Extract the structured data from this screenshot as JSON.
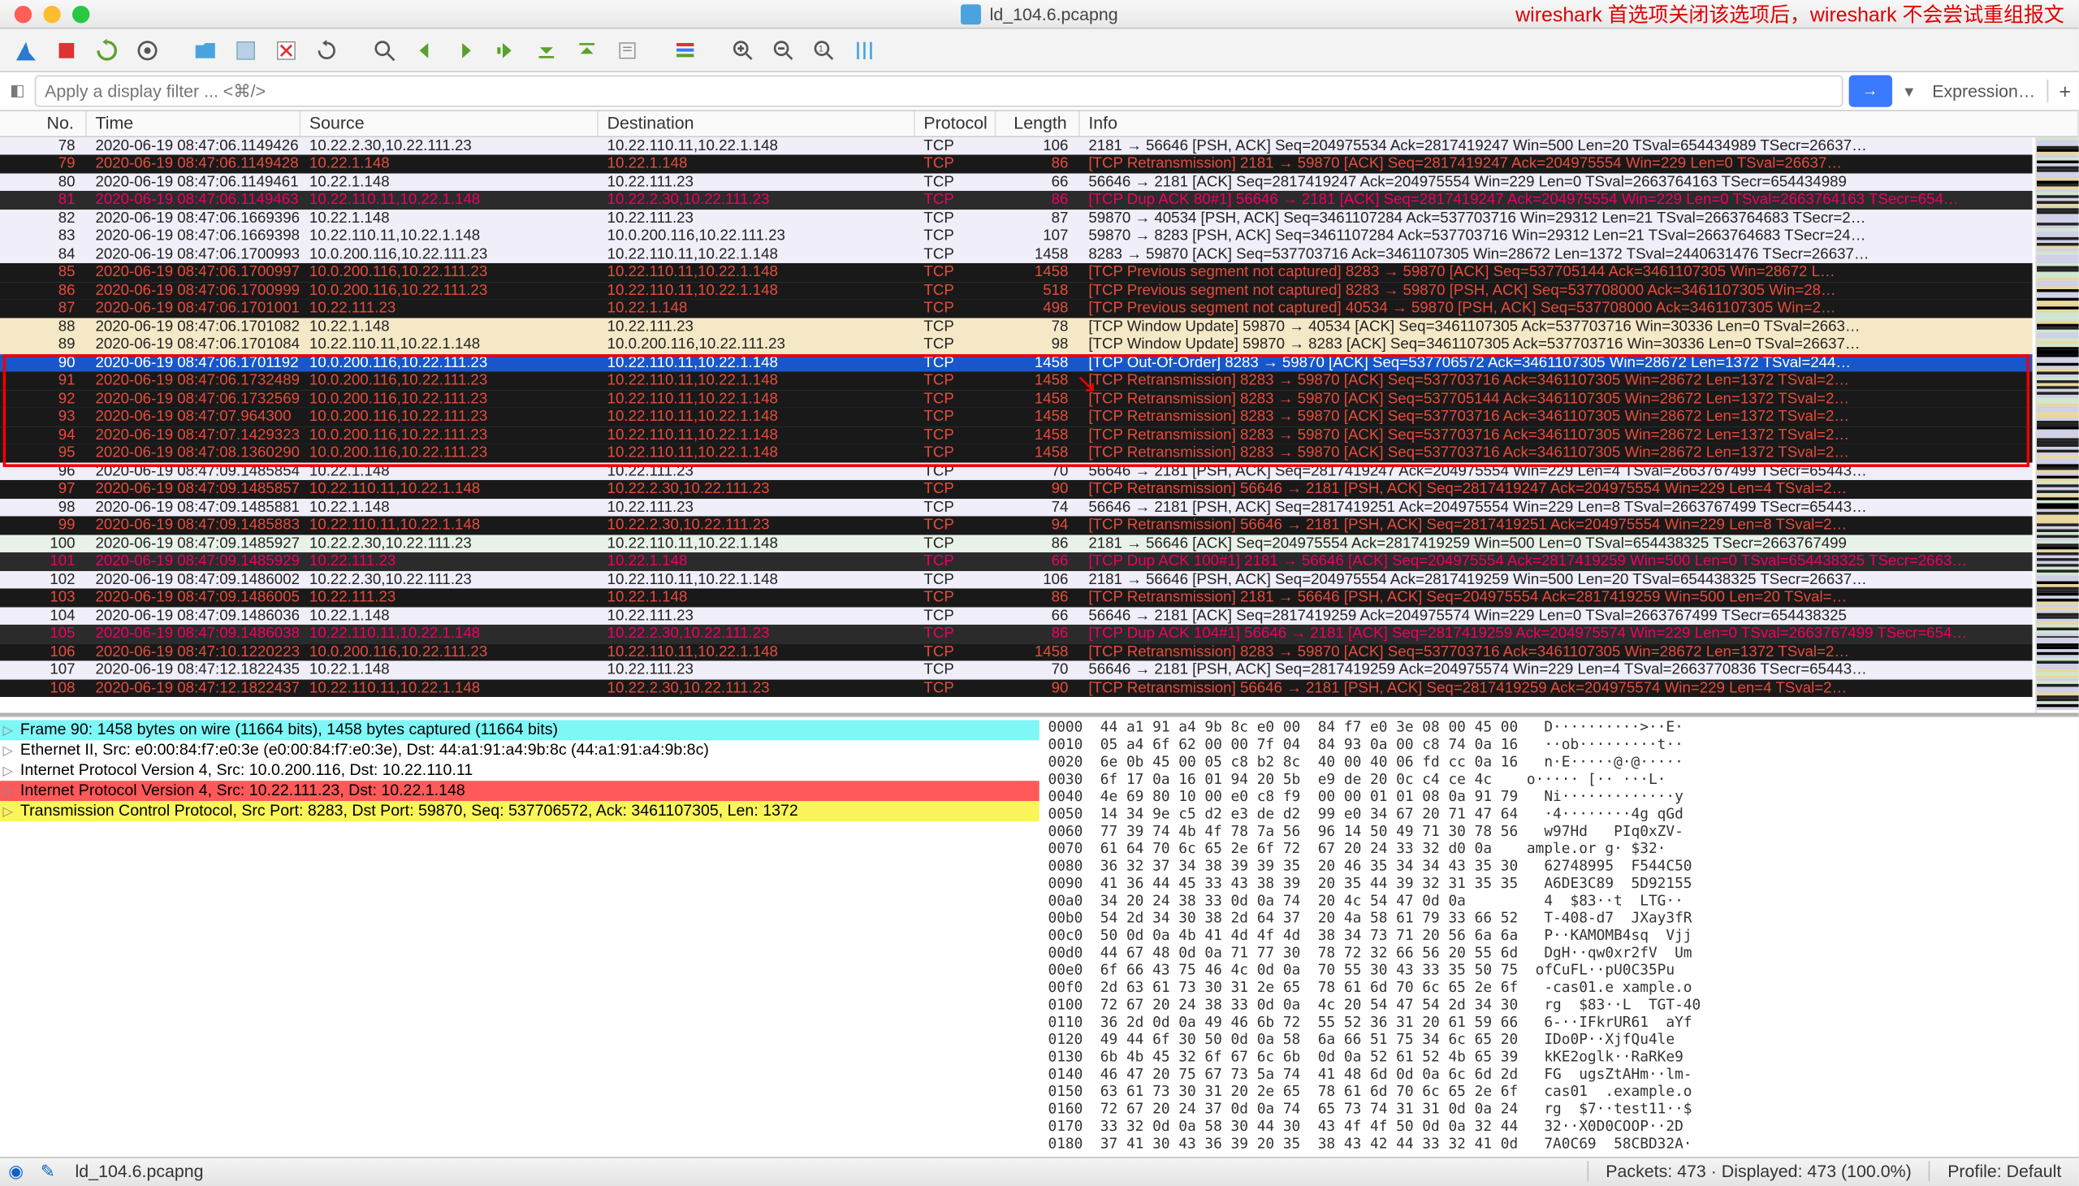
{
  "title": "ld_104.6.pcapng",
  "annotation": "wireshark 首选项关闭该选项后，wireshark 不会尝试重组报文",
  "filter_placeholder": "Apply a display filter ... <⌘/>",
  "expression_label": "Expression…",
  "columns": {
    "no": "No.",
    "time": "Time",
    "src": "Source",
    "dst": "Destination",
    "proto": "Protocol",
    "len": "Length",
    "info": "Info"
  },
  "rows": [
    {
      "n": 78,
      "t": "2020-06-19 08:47:06.1149426",
      "s": "10.22.2.30,10.22.111.23",
      "d": "10.22.110.11,10.22.1.148",
      "p": "TCP",
      "l": 106,
      "i": "2181 → 56646 [PSH, ACK] Seq=204975534 Ack=2817419247 Win=500 Len=20 TSval=654434989 TSecr=26637…",
      "cls": "c-light"
    },
    {
      "n": 79,
      "t": "2020-06-19 08:47:06.1149428",
      "s": "10.22.1.148",
      "d": "10.22.1.148",
      "p": "TCP",
      "l": 86,
      "i": "[TCP Retransmission] 2181 → 59870 [ACK] Seq=2817419247 Ack=204975554 Win=229 Len=0 TSval=26637…",
      "cls": "c-black"
    },
    {
      "n": 80,
      "t": "2020-06-19 08:47:06.1149461",
      "s": "10.22.1.148",
      "d": "10.22.111.23",
      "p": "TCP",
      "l": 66,
      "i": "56646 → 2181 [ACK] Seq=2817419247 Ack=204975554 Win=229 Len=0 TSval=2663764163 TSecr=654434989",
      "cls": "c-light"
    },
    {
      "n": 81,
      "t": "2020-06-19 08:47:06.1149463",
      "s": "10.22.110.11,10.22.1.148",
      "d": "10.22.2.30,10.22.111.23",
      "p": "TCP",
      "l": 86,
      "i": "[TCP Dup ACK 80#1] 56646 → 2181 [ACK] Seq=2817419247 Ack=204975554 Win=229 Len=0 TSval=2663764163 TSecr=654…",
      "cls": "c-dark"
    },
    {
      "n": 82,
      "t": "2020-06-19 08:47:06.1669396",
      "s": "10.22.1.148",
      "d": "10.22.111.23",
      "p": "TCP",
      "l": 87,
      "i": "59870 → 40534 [PSH, ACK] Seq=3461107284 Ack=537703716 Win=29312 Len=21 TSval=2663764683 TSecr=2…",
      "cls": "c-light"
    },
    {
      "n": 83,
      "t": "2020-06-19 08:47:06.1669398",
      "s": "10.22.110.11,10.22.1.148",
      "d": "10.0.200.116,10.22.111.23",
      "p": "TCP",
      "l": 107,
      "i": "59870 → 8283 [PSH, ACK] Seq=3461107284 Ack=537703716 Win=29312 Len=21 TSval=2663764683 TSecr=24…",
      "cls": "c-light"
    },
    {
      "n": 84,
      "t": "2020-06-19 08:47:06.1700993",
      "s": "10.0.200.116,10.22.111.23",
      "d": "10.22.110.11,10.22.1.148",
      "p": "TCP",
      "l": 1458,
      "i": "8283 → 59870 [ACK] Seq=537703716 Ack=3461107305 Win=28672 Len=1372 TSval=2440631476 TSecr=26637…",
      "cls": "c-light"
    },
    {
      "n": 85,
      "t": "2020-06-19 08:47:06.1700997",
      "s": "10.0.200.116,10.22.111.23",
      "d": "10.22.110.11,10.22.1.148",
      "p": "TCP",
      "l": 1458,
      "i": "[TCP Previous segment not captured] 8283 → 59870 [ACK] Seq=537705144 Ack=3461107305 Win=28672 L…",
      "cls": "c-black"
    },
    {
      "n": 86,
      "t": "2020-06-19 08:47:06.1700999",
      "s": "10.0.200.116,10.22.111.23",
      "d": "10.22.110.11,10.22.1.148",
      "p": "TCP",
      "l": 518,
      "i": "[TCP Previous segment not captured] 8283 → 59870 [PSH, ACK] Seq=537708000 Ack=3461107305 Win=28…",
      "cls": "c-black"
    },
    {
      "n": 87,
      "t": "2020-06-19 08:47:06.1701001",
      "s": "10.22.111.23",
      "d": "10.22.1.148",
      "p": "TCP",
      "l": 498,
      "i": "[TCP Previous segment not captured] 40534 → 59870 [PSH, ACK] Seq=537708000 Ack=3461107305 Win=2…",
      "cls": "c-black"
    },
    {
      "n": 88,
      "t": "2020-06-19 08:47:06.1701082",
      "s": "10.22.1.148",
      "d": "10.22.111.23",
      "p": "TCP",
      "l": 78,
      "i": "[TCP Window Update] 59870 → 40534 [ACK] Seq=3461107305 Ack=537703716 Win=30336 Len=0 TSval=2663…",
      "cls": "c-tan"
    },
    {
      "n": 89,
      "t": "2020-06-19 08:47:06.1701084",
      "s": "10.22.110.11,10.22.1.148",
      "d": "10.0.200.116,10.22.111.23",
      "p": "TCP",
      "l": 98,
      "i": "[TCP Window Update] 59870 → 8283 [ACK] Seq=3461107305 Ack=537703716 Win=30336 Len=0 TSval=26637…",
      "cls": "c-tan"
    },
    {
      "n": 90,
      "t": "2020-06-19 08:47:06.1701192",
      "s": "10.0.200.116,10.22.111.23",
      "d": "10.22.110.11,10.22.1.148",
      "p": "TCP",
      "l": 1458,
      "i": "[TCP Out-Of-Order] 8283 → 59870 [ACK] Seq=537706572 Ack=3461107305 Win=28672 Len=1372 TSval=244…",
      "cls": "c-sel"
    },
    {
      "n": 91,
      "t": "2020-06-19 08:47:06.1732489",
      "s": "10.0.200.116,10.22.111.23",
      "d": "10.22.110.11,10.22.1.148",
      "p": "TCP",
      "l": 1458,
      "i": "[TCP Retransmission] 8283 → 59870 [ACK] Seq=537703716 Ack=3461107305 Win=28672 Len=1372 TSval=2…",
      "cls": "c-red-on-black"
    },
    {
      "n": 92,
      "t": "2020-06-19 08:47:06.1732569",
      "s": "10.0.200.116,10.22.111.23",
      "d": "10.22.110.11,10.22.1.148",
      "p": "TCP",
      "l": 1458,
      "i": "[TCP Retransmission] 8283 → 59870 [ACK] Seq=537705144 Ack=3461107305 Win=28672 Len=1372 TSval=2…",
      "cls": "c-red-on-black"
    },
    {
      "n": 93,
      "t": "2020-06-19 08:47:07.964300",
      "s": "10.0.200.116,10.22.111.23",
      "d": "10.22.110.11,10.22.1.148",
      "p": "TCP",
      "l": 1458,
      "i": "[TCP Retransmission] 8283 → 59870 [ACK] Seq=537703716 Ack=3461107305 Win=28672 Len=1372 TSval=2…",
      "cls": "c-red-on-black"
    },
    {
      "n": 94,
      "t": "2020-06-19 08:47:07.1429323",
      "s": "10.0.200.116,10.22.111.23",
      "d": "10.22.110.11,10.22.1.148",
      "p": "TCP",
      "l": 1458,
      "i": "[TCP Retransmission] 8283 → 59870 [ACK] Seq=537703716 Ack=3461107305 Win=28672 Len=1372 TSval=2…",
      "cls": "c-red-on-black"
    },
    {
      "n": 95,
      "t": "2020-06-19 08:47:08.1360290",
      "s": "10.0.200.116,10.22.111.23",
      "d": "10.22.110.11,10.22.1.148",
      "p": "TCP",
      "l": 1458,
      "i": "[TCP Retransmission] 8283 → 59870 [ACK] Seq=537703716 Ack=3461107305 Win=28672 Len=1372 TSval=2…",
      "cls": "c-red-on-black"
    },
    {
      "n": 96,
      "t": "2020-06-19 08:47:09.1485854",
      "s": "10.22.1.148",
      "d": "10.22.111.23",
      "p": "TCP",
      "l": 70,
      "i": "56646 → 2181 [PSH, ACK] Seq=2817419247 Ack=204975554 Win=229 Len=4 TSval=2663767499 TSecr=65443…",
      "cls": "c-light"
    },
    {
      "n": 97,
      "t": "2020-06-19 08:47:09.1485857",
      "s": "10.22.110.11,10.22.1.148",
      "d": "10.22.2.30,10.22.111.23",
      "p": "TCP",
      "l": 90,
      "i": "[TCP Retransmission] 56646 → 2181 [PSH, ACK] Seq=2817419247 Ack=204975554 Win=229 Len=4 TSval=2…",
      "cls": "c-black"
    },
    {
      "n": 98,
      "t": "2020-06-19 08:47:09.1485881",
      "s": "10.22.1.148",
      "d": "10.22.111.23",
      "p": "TCP",
      "l": 74,
      "i": "56646 → 2181 [PSH, ACK] Seq=2817419251 Ack=204975554 Win=229 Len=8 TSval=2663767499 TSecr=65443…",
      "cls": "c-light"
    },
    {
      "n": 99,
      "t": "2020-06-19 08:47:09.1485883",
      "s": "10.22.110.11,10.22.1.148",
      "d": "10.22.2.30,10.22.111.23",
      "p": "TCP",
      "l": 94,
      "i": "[TCP Retransmission] 56646 → 2181 [PSH, ACK] Seq=2817419251 Ack=204975554 Win=229 Len=8 TSval=2…",
      "cls": "c-black"
    },
    {
      "n": 100,
      "t": "2020-06-19 08:47:09.1485927",
      "s": "10.22.2.30,10.22.111.23",
      "d": "10.22.110.11,10.22.1.148",
      "p": "TCP",
      "l": 86,
      "i": "2181 → 56646 [ACK] Seq=204975554 Ack=2817419259 Win=500 Len=0 TSval=654438325 TSecr=2663767499",
      "cls": "c-pale"
    },
    {
      "n": 101,
      "t": "2020-06-19 08:47:09.1485929",
      "s": "10.22.111.23",
      "d": "10.22.1.148",
      "p": "TCP",
      "l": 66,
      "i": "[TCP Dup ACK 100#1] 2181 → 56646 [ACK] Seq=204975554 Ack=2817419259 Win=500 Len=0 TSval=654438325 TSecr=2663…",
      "cls": "c-dark"
    },
    {
      "n": 102,
      "t": "2020-06-19 08:47:09.1486002",
      "s": "10.22.2.30,10.22.111.23",
      "d": "10.22.110.11,10.22.1.148",
      "p": "TCP",
      "l": 106,
      "i": "2181 → 56646 [PSH, ACK] Seq=204975554 Ack=2817419259 Win=500 Len=20 TSval=654438325 TSecr=26637…",
      "cls": "c-light"
    },
    {
      "n": 103,
      "t": "2020-06-19 08:47:09.1486005",
      "s": "10.22.111.23",
      "d": "10.22.1.148",
      "p": "TCP",
      "l": 86,
      "i": "[TCP Retransmission] 2181 → 56646 [PSH, ACK] Seq=204975554 Ack=2817419259 Win=500 Len=20 TSval=…",
      "cls": "c-black"
    },
    {
      "n": 104,
      "t": "2020-06-19 08:47:09.1486036",
      "s": "10.22.1.148",
      "d": "10.22.111.23",
      "p": "TCP",
      "l": 66,
      "i": "56646 → 2181 [ACK] Seq=2817419259 Ack=204975574 Win=229 Len=0 TSval=2663767499 TSecr=654438325",
      "cls": "c-light"
    },
    {
      "n": 105,
      "t": "2020-06-19 08:47:09.1486038",
      "s": "10.22.110.11,10.22.1.148",
      "d": "10.22.2.30,10.22.111.23",
      "p": "TCP",
      "l": 86,
      "i": "[TCP Dup ACK 104#1] 56646 → 2181 [ACK] Seq=2817419259 Ack=204975574 Win=229 Len=0 TSval=2663767499 TSecr=654…",
      "cls": "c-dark"
    },
    {
      "n": 106,
      "t": "2020-06-19 08:47:10.1220223",
      "s": "10.0.200.116,10.22.111.23",
      "d": "10.22.110.11,10.22.1.148",
      "p": "TCP",
      "l": 1458,
      "i": "[TCP Retransmission] 8283 → 59870 [ACK] Seq=537703716 Ack=3461107305 Win=28672 Len=1372 TSval=2…",
      "cls": "c-red-on-black"
    },
    {
      "n": 107,
      "t": "2020-06-19 08:47:12.1822435",
      "s": "10.22.1.148",
      "d": "10.22.111.23",
      "p": "TCP",
      "l": 70,
      "i": "56646 → 2181 [PSH, ACK] Seq=2817419259 Ack=204975574 Win=229 Len=4 TSval=2663770836 TSecr=65443…",
      "cls": "c-light"
    },
    {
      "n": 108,
      "t": "2020-06-19 08:47:12.1822437",
      "s": "10.22.110.11,10.22.1.148",
      "d": "10.22.2.30,10.22.111.23",
      "p": "TCP",
      "l": 90,
      "i": "[TCP Retransmission] 56646 → 2181 [PSH, ACK] Seq=2817419259 Ack=204975574 Win=229 Len=4 TSval=2…",
      "cls": "c-black"
    }
  ],
  "details": {
    "l0": "Frame 90: 1458 bytes on wire (11664 bits), 1458 bytes captured (11664 bits)",
    "l1": "Ethernet II, Src: e0:00:84:f7:e0:3e (e0:00:84:f7:e0:3e), Dst: 44:a1:91:a4:9b:8c (44:a1:91:a4:9b:8c)",
    "l2": "Internet Protocol Version 4, Src: 10.0.200.116, Dst: 10.22.110.11",
    "l3": "Internet Protocol Version 4, Src: 10.22.111.23, Dst: 10.22.1.148",
    "l4": "Transmission Control Protocol, Src Port: 8283, Dst Port: 59870, Seq: 537706572, Ack: 3461107305, Len: 1372"
  },
  "hex": "0000  44 a1 91 a4 9b 8c e0 00  84 f7 e0 3e 08 00 45 00   D··········>··E·\n0010  05 a4 6f 62 00 00 7f 04  84 93 0a 00 c8 74 0a 16   ··ob·········t··\n0020  6e 0b 45 00 05 c8 b2 8c  40 00 40 06 fd cc 0a 16   n·E·····@·@·····\n0030  6f 17 0a 16 01 94 20 5b  e9 de 20 0c c4 ce 4c    o····· [·· ···L·\n0040  4e 69 80 10 00 e0 c8 f9  00 00 01 01 08 0a 91 79   Ni·············y\n0050  14 34 9e c5 d2 e3 de d2  99 e0 34 67 20 71 47 64   ·4········4g qGd\n0060  77 39 74 4b 4f 78 7a 56  96 14 50 49 71 30 78 56   w97Hd   PIq0xZV-\n0070  61 64 70 6c 65 2e 6f 72  67 20 24 33 32 d0 0a    ample.or g· $32·\n0080  36 32 37 34 38 39 39 35  20 46 35 34 34 43 35 30   62748995  F544C50\n0090  41 36 44 45 33 43 38 39  20 35 44 39 32 31 35 35   A6DE3C89  5D92155\n00a0  34 20 24 38 33 0d 0a 74  20 4c 54 47 0d 0a         4  $83··t  LTG··\n00b0  54 2d 34 30 38 2d 64 37  20 4a 58 61 79 33 66 52   T-408-d7  JXay3fR\n00c0  50 0d 0a 4b 41 4d 4f 4d  38 34 73 71 20 56 6a 6a   P··KAMOMB4sq  Vjj\n00d0  44 67 48 0d 0a 71 77 30  78 72 32 66 56 20 55 6d   DgH··qw0xr2fV  Um\n00e0  6f 66 43 75 46 4c 0d 0a  70 55 30 43 33 35 50 75  ofCuFL··pU0C35Pu\n00f0  2d 63 61 73 30 31 2e 65  78 61 6d 70 6c 65 2e 6f   -cas01.e xample.o\n0100  72 67 20 24 38 33 0d 0a  4c 20 54 47 54 2d 34 30   rg  $83··L  TGT-40\n0110  36 2d 0d 0a 49 46 6b 72  55 52 36 31 20 61 59 66   6-··IFkrUR61  aYf\n0120  49 44 6f 30 50 0d 0a 58  6a 66 51 75 34 6c 65 20   IDo0P··XjfQu4le \n0130  6b 4b 45 32 6f 67 6c 6b  0d 0a 52 61 52 4b 65 39   kKE2oglk··RaRKe9\n0140  46 47 20 75 67 73 5a 74  41 48 6d 0d 0a 6c 6d 2d   FG  ugsZtAHm··lm-\n0150  63 61 73 30 31 20 2e 65  78 61 6d 70 6c 65 2e 6f   cas01  .example.o\n0160  72 67 20 24 37 0d 0a 74  65 73 74 31 31 0d 0a 24   rg  $7··test11··$\n0170  33 32 0d 0a 58 30 44 30  43 4f 4f 50 0d 0a 32 44   32··X0D0COOP··2D\n0180  37 41 30 43 36 39 20 35  38 43 42 44 33 32 41 0d   7A0C69  58CBD32A·",
  "status": {
    "filename": "ld_104.6.pcapng",
    "packets": "Packets: 473 · Displayed: 473 (100.0%)",
    "profile": "Profile: Default"
  }
}
